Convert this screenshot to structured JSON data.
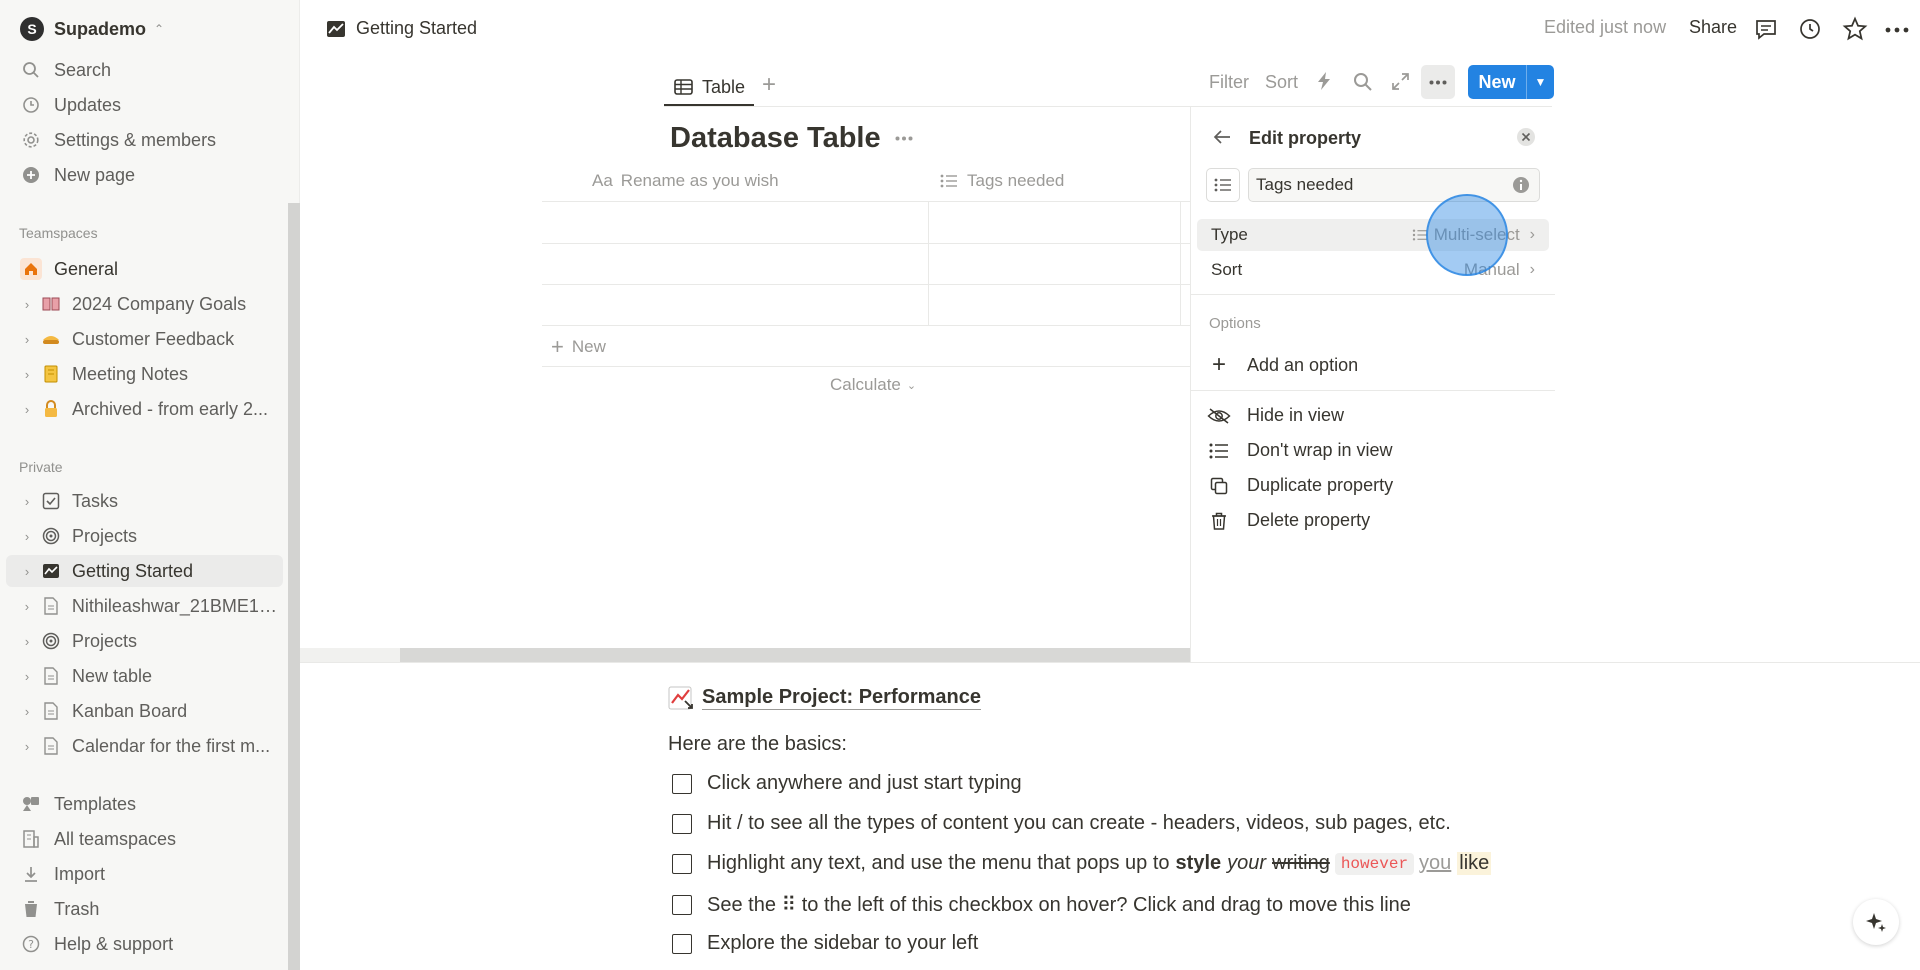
{
  "workspace": {
    "name": "Supademo",
    "initial": "S"
  },
  "sidebar": {
    "top_items": [
      {
        "label": "Search",
        "icon": "search-icon"
      },
      {
        "label": "Updates",
        "icon": "clock-icon"
      },
      {
        "label": "Settings & members",
        "icon": "gear-icon"
      },
      {
        "label": "New page",
        "icon": "plus-circle-icon"
      }
    ],
    "teamspaces_header": "Teamspaces",
    "general_label": "General",
    "teamspace_items": [
      {
        "label": "2024 Company Goals",
        "icon": "book-icon"
      },
      {
        "label": "Customer Feedback",
        "icon": "pie-icon"
      },
      {
        "label": "Meeting Notes",
        "icon": "notebook-icon"
      },
      {
        "label": "Archived - from early 2...",
        "icon": "lock-icon"
      }
    ],
    "private_header": "Private",
    "private_items": [
      {
        "label": "Tasks",
        "icon": "checkbox-icon"
      },
      {
        "label": "Projects",
        "icon": "target-icon"
      },
      {
        "label": "Getting Started",
        "icon": "chart-icon"
      },
      {
        "label": "Nithileashwar_21BME10...",
        "icon": "page-icon"
      },
      {
        "label": "Projects",
        "icon": "target-icon"
      },
      {
        "label": "New table",
        "icon": "page-icon"
      },
      {
        "label": "Kanban Board",
        "icon": "page-icon"
      },
      {
        "label": "Calendar for the first m...",
        "icon": "page-icon"
      }
    ],
    "bottom_items": [
      {
        "label": "Templates",
        "icon": "templates-icon"
      },
      {
        "label": "All teamspaces",
        "icon": "building-icon"
      },
      {
        "label": "Import",
        "icon": "import-icon"
      },
      {
        "label": "Trash",
        "icon": "trash-icon"
      },
      {
        "label": "Help & support",
        "icon": "help-icon"
      }
    ]
  },
  "topbar": {
    "breadcrumb": "Getting Started",
    "edited": "Edited just now",
    "share": "Share"
  },
  "db": {
    "tab_label": "Table",
    "filter": "Filter",
    "sort": "Sort",
    "new_label": "New",
    "title": "Database Table",
    "col1_prefix": "Aa",
    "col1": "Rename as you wish",
    "col2": "Tags needed",
    "new_row": "New",
    "calculate": "Calculate"
  },
  "panel": {
    "title": "Edit property",
    "name_value": "Tags needed",
    "type_label": "Type",
    "type_value": "Multi-select",
    "sort_label": "Sort",
    "sort_value": "Manual",
    "options_header": "Options",
    "add_option": "Add an option",
    "actions": [
      {
        "label": "Hide in view",
        "icon": "eye-slash-icon"
      },
      {
        "label": "Don't wrap in view",
        "icon": "list-icon"
      },
      {
        "label": "Duplicate property",
        "icon": "duplicate-icon"
      },
      {
        "label": "Delete property",
        "icon": "trash-icon"
      }
    ]
  },
  "content": {
    "link_title": "Sample Project: Performance",
    "basics": "Here are the basics:",
    "todo1": "Click anywhere and just start typing",
    "todo2": "Hit / to see all the types of content you can create - headers, videos, sub pages, etc.",
    "todo3": {
      "a": "Highlight any text, and use the menu that pops up to",
      "style": "style",
      "your": "your",
      "writing": "writing",
      "however": "however",
      "you": "you",
      "like": "like"
    },
    "todo4": "See the ⠿ to the left of this checkbox on hover? Click and drag to move this line",
    "todo5": "Explore the sidebar to your left"
  },
  "colors": {
    "accent": "#2383e2",
    "sidebar_bg": "#f7f7f5"
  }
}
